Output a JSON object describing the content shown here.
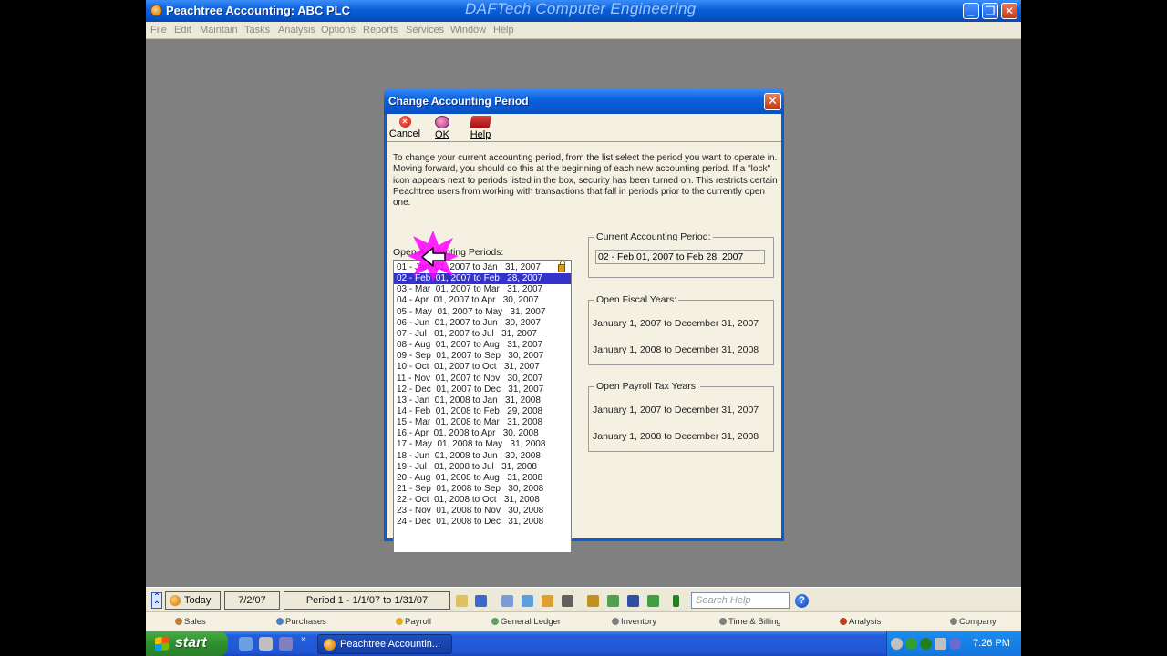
{
  "window": {
    "title": "Peachtree Accounting: ABC PLC",
    "brand_watermark": "DAFTech Computer Engineering",
    "minimize": "_",
    "restore": "❐",
    "close": "✕"
  },
  "menu": [
    "File",
    "Edit",
    "Maintain",
    "Tasks",
    "Analysis",
    "Options",
    "Reports",
    "Services",
    "Window",
    "Help"
  ],
  "dialog": {
    "title": "Change Accounting Period",
    "close": "✕",
    "toolbar": {
      "cancel": "Cancel",
      "ok": "OK",
      "help": "Help"
    },
    "instructions": "To change your current accounting period, from the list select the period you want to operate in. Moving forward, you should do this at the beginning of each new accounting period.  If a \"lock\" icon appears next to periods listed in the box, security has been turned on.  This restricts certain Peachtree users from working with transactions that fall in periods prior to the currently open one.",
    "list_label": "Open Accounting Periods:",
    "periods": [
      "01 - Jan  01, 2007 to Jan   31, 2007",
      "02 - Feb  01, 2007 to Feb   28, 2007",
      "03 - Mar  01, 2007 to Mar   31, 2007",
      "04 - Apr  01, 2007 to Apr   30, 2007",
      "05 - May  01, 2007 to May   31, 2007",
      "06 - Jun  01, 2007 to Jun   30, 2007",
      "07 - Jul   01, 2007 to Jul   31, 2007",
      "08 - Aug  01, 2007 to Aug   31, 2007",
      "09 - Sep  01, 2007 to Sep   30, 2007",
      "10 - Oct  01, 2007 to Oct   31, 2007",
      "11 - Nov  01, 2007 to Nov   30, 2007",
      "12 - Dec  01, 2007 to Dec   31, 2007",
      "13 - Jan  01, 2008 to Jan   31, 2008",
      "14 - Feb  01, 2008 to Feb   29, 2008",
      "15 - Mar  01, 2008 to Mar   31, 2008",
      "16 - Apr  01, 2008 to Apr   30, 2008",
      "17 - May  01, 2008 to May   31, 2008",
      "18 - Jun  01, 2008 to Jun   30, 2008",
      "19 - Jul   01, 2008 to Jul   31, 2008",
      "20 - Aug  01, 2008 to Aug   31, 2008",
      "21 - Sep  01, 2008 to Sep   30, 2008",
      "22 - Oct  01, 2008 to Oct   31, 2008",
      "23 - Nov  01, 2008 to Nov   30, 2008",
      "24 - Dec  01, 2008 to Dec   31, 2008"
    ],
    "selected_index": 1,
    "locked_index": 0,
    "current_period": {
      "title": "Current Accounting Period:",
      "value": "02 - Feb 01, 2007 to Feb 28, 2007"
    },
    "fiscal_years": {
      "title": "Open Fiscal Years:",
      "years": [
        "January 1, 2007 to December 31, 2007",
        "January 1, 2008 to December 31, 2008"
      ]
    },
    "payroll_years": {
      "title": "Open Payroll Tax Years:",
      "years": [
        "January 1, 2007 to December 31, 2007",
        "January 1, 2008 to December 31, 2008"
      ]
    }
  },
  "navbar": {
    "today": "Today",
    "date": "7/2/07",
    "period": "Period 1 - 1/1/07 to 1/31/07",
    "search_placeholder": "Search Help",
    "help": "?"
  },
  "navigation_centers": [
    "Sales",
    "Purchases",
    "Payroll",
    "General Ledger",
    "Inventory",
    "Time & Billing",
    "Analysis",
    "Company"
  ],
  "taskbar": {
    "start": "start",
    "task": "Peachtree Accountin...",
    "clock": "7:26 PM"
  },
  "colors": {
    "selection": "#3333cc",
    "title_blue": "#0a5fd8",
    "desktop_gray": "#808080",
    "dialog_bg": "#f4f1e3",
    "highlight_star": "#ff00ff"
  }
}
